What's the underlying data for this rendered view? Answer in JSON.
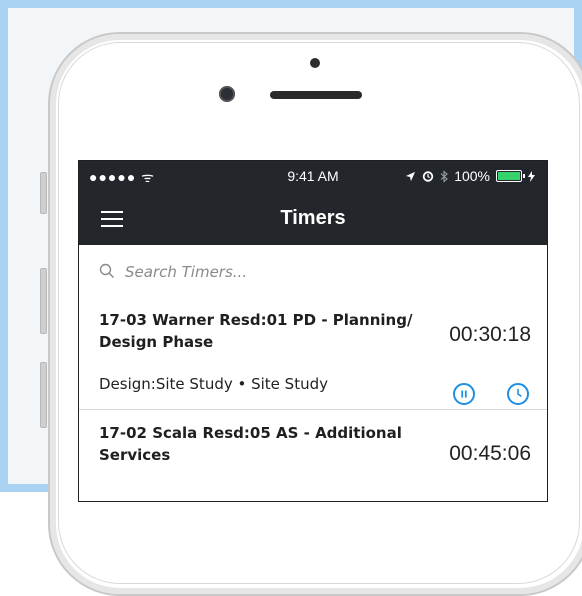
{
  "status_bar": {
    "signal": "●●●●● ᯤ",
    "time": "9:41 AM",
    "battery": "100%"
  },
  "header": {
    "title": "Timers"
  },
  "search": {
    "placeholder": "Search Timers..."
  },
  "timers": [
    {
      "title": "17-03 Warner Resd:01 PD - Planning/ Design Phase",
      "elapsed": "00:30:18",
      "subtitle": "Design:Site Study • Site Study"
    },
    {
      "title": "17-02 Scala Resd:05 AS - Additional Services",
      "elapsed": "00:45:06"
    }
  ],
  "colors": {
    "header_bg": "#23272b",
    "accent": "#1e8fe3",
    "frame": "#a9d2f3"
  }
}
